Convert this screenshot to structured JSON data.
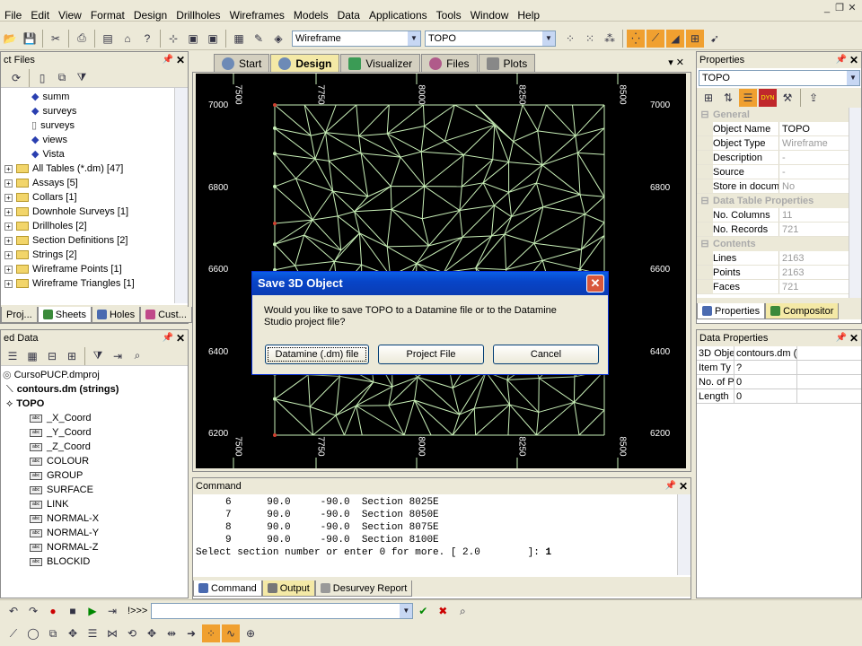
{
  "menu": [
    "File",
    "Edit",
    "View",
    "Format",
    "Design",
    "Drillholes",
    "Wireframes",
    "Models",
    "Data",
    "Applications",
    "Tools",
    "Window",
    "Help"
  ],
  "toolbar": {
    "wireframe_combo": "Wireframe",
    "object_combo": "TOPO"
  },
  "project_files": {
    "title": "ct Files",
    "items": [
      {
        "label": "summ",
        "type": "table"
      },
      {
        "label": "surveys",
        "type": "table"
      },
      {
        "label": "surveys",
        "type": "file"
      },
      {
        "label": "views",
        "type": "table"
      },
      {
        "label": "Vista",
        "type": "table"
      }
    ],
    "folders": [
      "All Tables (*.dm) [47]",
      "Assays [5]",
      "Collars [1]",
      "Downhole Surveys [1]",
      "Drillholes [2]",
      "Section Definitions [2]",
      "Strings [2]",
      "Wireframe Points [1]",
      "Wireframe Triangles [1]"
    ],
    "tabs": [
      "Proj...",
      "Sheets",
      "Holes",
      "Cust..."
    ]
  },
  "loaded_data": {
    "title": "ed Data",
    "project": "CursoPUCP.dmproj",
    "objects": [
      "contours.dm (strings)",
      "TOPO"
    ],
    "fields": [
      "_X_Coord",
      "_Y_Coord",
      "_Z_Coord",
      "COLOUR",
      "GROUP",
      "SURFACE",
      "LINK",
      "NORMAL-X",
      "NORMAL-Y",
      "NORMAL-Z",
      "BLOCKID"
    ]
  },
  "doc_tabs": [
    "Start",
    "Design",
    "Visualizer",
    "Files",
    "Plots"
  ],
  "viewport": {
    "x_labels": [
      "7500",
      "7750",
      "8000",
      "8250",
      "8500"
    ],
    "y_labels": [
      "7000",
      "6800",
      "6600",
      "6400",
      "6200"
    ]
  },
  "properties": {
    "title": "Properties",
    "combo": "TOPO",
    "general_header": "General",
    "general": [
      {
        "name": "Object Name",
        "value": "TOPO"
      },
      {
        "name": "Object Type",
        "value": "Wireframe"
      },
      {
        "name": "Description",
        "value": "-"
      },
      {
        "name": "Source",
        "value": "-"
      },
      {
        "name": "Store in docum",
        "value": "No"
      }
    ],
    "table_header": "Data Table Properties",
    "table": [
      {
        "name": "No. Columns",
        "value": "11"
      },
      {
        "name": "No. Records",
        "value": "721"
      }
    ],
    "contents_header": "Contents",
    "contents": [
      {
        "name": "Lines",
        "value": "2163"
      },
      {
        "name": "Points",
        "value": "2163"
      },
      {
        "name": "Faces",
        "value": "721"
      }
    ],
    "tabs": [
      "Properties",
      "Compositor"
    ]
  },
  "data_properties": {
    "title": "Data Properties",
    "rows": [
      {
        "name": "3D Obje",
        "value": "contours.dm ("
      },
      {
        "name": "Item Ty",
        "value": "?"
      },
      {
        "name": "No. of P",
        "value": "0"
      },
      {
        "name": "Length",
        "value": "0"
      }
    ]
  },
  "command": {
    "title": "Command",
    "lines": [
      "     6      90.0     -90.0  Section 8025E",
      "     7      90.0     -90.0  Section 8050E",
      "     8      90.0     -90.0  Section 8075E",
      "     9      90.0     -90.0  Section 8100E"
    ],
    "prompt": "Select section number or enter 0 for more. [ 2.0        ]: ",
    "prompt_value": "1",
    "tabs": [
      "Command",
      "Output",
      "Desurvey Report"
    ]
  },
  "dialog": {
    "title": "Save 3D Object",
    "message": "Would you like to save TOPO to a Datamine file or to the Datamine Studio project file?",
    "buttons": [
      "Datamine (.dm) file",
      "Project File",
      "Cancel"
    ]
  },
  "status": {
    "command_prefix": "!>>>"
  }
}
